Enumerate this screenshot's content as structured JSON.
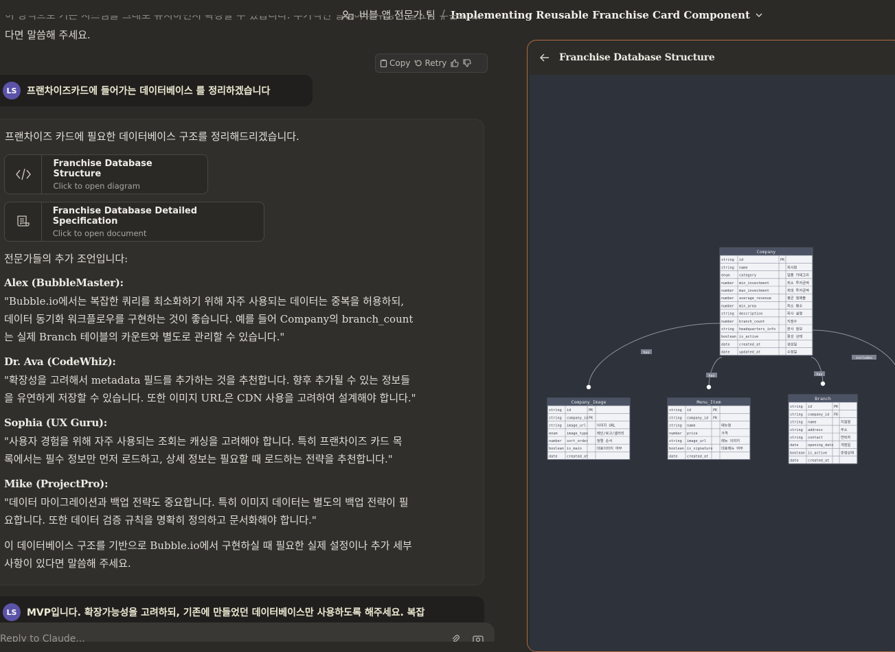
{
  "header": {
    "project_name": "버블 앱 전문가 팀",
    "chat_title": "Implementing Reusable Franchise Card Component"
  },
  "prev_message": {
    "line1": "이 방식으로 기존 시스템을 그대로 유지하면서 확장할 수 있습니다. 추가적인 설명이나 수정이 필요한 부분이 있",
    "line2": "다면 말씀해 주세요."
  },
  "actions": {
    "copy": "Copy",
    "retry": "Retry"
  },
  "user_message_1": {
    "avatar": "LS",
    "text": "프랜차이즈카드에 들어가는 데이터베이스 를 정리하겠습니다"
  },
  "assistant": {
    "intro": "프랜차이즈 카드에 필요한 데이터베이스 구조를 정리해드리겠습니다.",
    "artifacts": [
      {
        "title": "Franchise Database Structure",
        "subtitle": "Click to open diagram"
      },
      {
        "title": "Franchise Database Detailed Specification",
        "subtitle": "Click to open document"
      }
    ],
    "advice_intro": "전문가들의 추가 조언입니다:",
    "experts": [
      {
        "name": "Alex (BubbleMaster):",
        "l1": "\"Bubble.io에서는 복잡한 쿼리를 최소화하기 위해 자주 사용되는 데이터는 중복을 허용하되,",
        "l2": "데이터 동기화 워크플로우를 구현하는 것이 좋습니다. 예를 들어 Company의 branch_count",
        "l3": "는 실제 Branch 테이블의 카운트와 별도로 관리할 수 있습니다.\""
      },
      {
        "name": "Dr. Ava (CodeWhiz):",
        "l1": "\"확장성을 고려해서 metadata 필드를 추가하는 것을 추천합니다. 향후 추가될 수 있는 정보들",
        "l2": "을 유연하게 저장할 수 있습니다. 또한 이미지 URL은 CDN 사용을 고려하여 설계해야 합니다.\""
      },
      {
        "name": "Sophia (UX Guru):",
        "l1": "\"사용자 경험을 위해 자주 사용되는 조회는 캐싱을 고려해야 합니다. 특히 프랜차이즈 카드 목",
        "l2": "록에서는 필수 정보만 먼저 로드하고, 상세 정보는 필요할 때 로드하는 전략을 추천합니다.\""
      },
      {
        "name": "Mike (ProjectPro):",
        "l1": "\"데이터 마이그레이션과 백업 전략도 중요합니다. 특히 이미지 데이터는 별도의 백업 전략이 필",
        "l2": "요합니다. 또한 데이터 검증 규칙을 명확히 정의하고 문서화해야 합니다.\""
      }
    ],
    "closing_l1": "이 데이터베이스 구조를 기반으로 Bubble.io에서 구현하실 때 필요한 실제 설정이나 추가 세부",
    "closing_l2": "사항이 있다면 말씀해 주세요."
  },
  "user_message_2": {
    "avatar": "LS",
    "text": "MVP입니다. 확장가능성을 고려하되, 기존에 만들었던 데이터베이스만 사용하도록 해주세요. 복잡"
  },
  "composer": {
    "placeholder": "Reply to Claude..."
  },
  "panel": {
    "title": "Franchise Database Structure"
  },
  "icons": {
    "back": "arrow-left-icon",
    "copy": "clipboard-icon",
    "retry": "retry-icon",
    "up": "thumbs-up-icon",
    "down": "thumbs-down-icon"
  },
  "colors": {
    "accent_border": "#b26b42",
    "avatar": "#5b53a8"
  },
  "diagram": {
    "tables": [
      {
        "name": "Company",
        "rows": [
          [
            "string",
            "id",
            "PK",
            ""
          ],
          [
            "string",
            "name",
            "",
            "회사명"
          ],
          [
            "enum",
            "category",
            "",
            "업종 카테고리"
          ],
          [
            "number",
            "min_investment",
            "",
            "최소 투자금액"
          ],
          [
            "number",
            "max_investment",
            "",
            "최대 투자금액"
          ],
          [
            "number",
            "average_revenue",
            "",
            "평균 월매출"
          ],
          [
            "number",
            "min_area",
            "",
            "최소 평수"
          ],
          [
            "string",
            "description",
            "",
            "회사 설명"
          ],
          [
            "number",
            "branch_count",
            "",
            "지점수"
          ],
          [
            "string",
            "headquarters_info",
            "",
            "본사 정보"
          ],
          [
            "boolean",
            "is_active",
            "",
            "활성 상태"
          ],
          [
            "date",
            "created_at",
            "",
            "생성일"
          ],
          [
            "date",
            "updated_at",
            "",
            "수정일"
          ]
        ]
      },
      {
        "name": "Company_Image",
        "rows": [
          [
            "string",
            "id",
            "PK",
            ""
          ],
          [
            "string",
            "company_id",
            "FK",
            ""
          ],
          [
            "string",
            "image_url",
            "",
            "이미지 URL"
          ],
          [
            "enum",
            "image_type",
            "",
            "메인/로고/갤러리"
          ],
          [
            "number",
            "sort_order",
            "",
            "정렬 순서"
          ],
          [
            "boolean",
            "is_main",
            "",
            "대표이미지 여부"
          ],
          [
            "date",
            "created_at",
            "",
            ""
          ]
        ]
      },
      {
        "name": "Menu_Item",
        "rows": [
          [
            "string",
            "id",
            "PK",
            ""
          ],
          [
            "string",
            "company_id",
            "FK",
            ""
          ],
          [
            "string",
            "name",
            "",
            "메뉴명"
          ],
          [
            "number",
            "price",
            "",
            "가격"
          ],
          [
            "string",
            "image_url",
            "",
            "메뉴 이미지"
          ],
          [
            "boolean",
            "is_signature",
            "",
            "대표메뉴 여부"
          ],
          [
            "date",
            "created_at",
            "",
            ""
          ]
        ]
      },
      {
        "name": "Branch",
        "rows": [
          [
            "string",
            "id",
            "PK",
            ""
          ],
          [
            "string",
            "company_id",
            "FK",
            ""
          ],
          [
            "string",
            "name",
            "",
            "지점명"
          ],
          [
            "string",
            "address",
            "",
            "주소"
          ],
          [
            "string",
            "contact",
            "",
            "연락처"
          ],
          [
            "date",
            "opening_date",
            "",
            "개점일"
          ],
          [
            "boolean",
            "is_active",
            "",
            "운영상태"
          ],
          [
            "date",
            "created_at",
            "",
            ""
          ]
        ]
      }
    ],
    "relations": [
      "has",
      "has",
      "has",
      "includes"
    ]
  }
}
